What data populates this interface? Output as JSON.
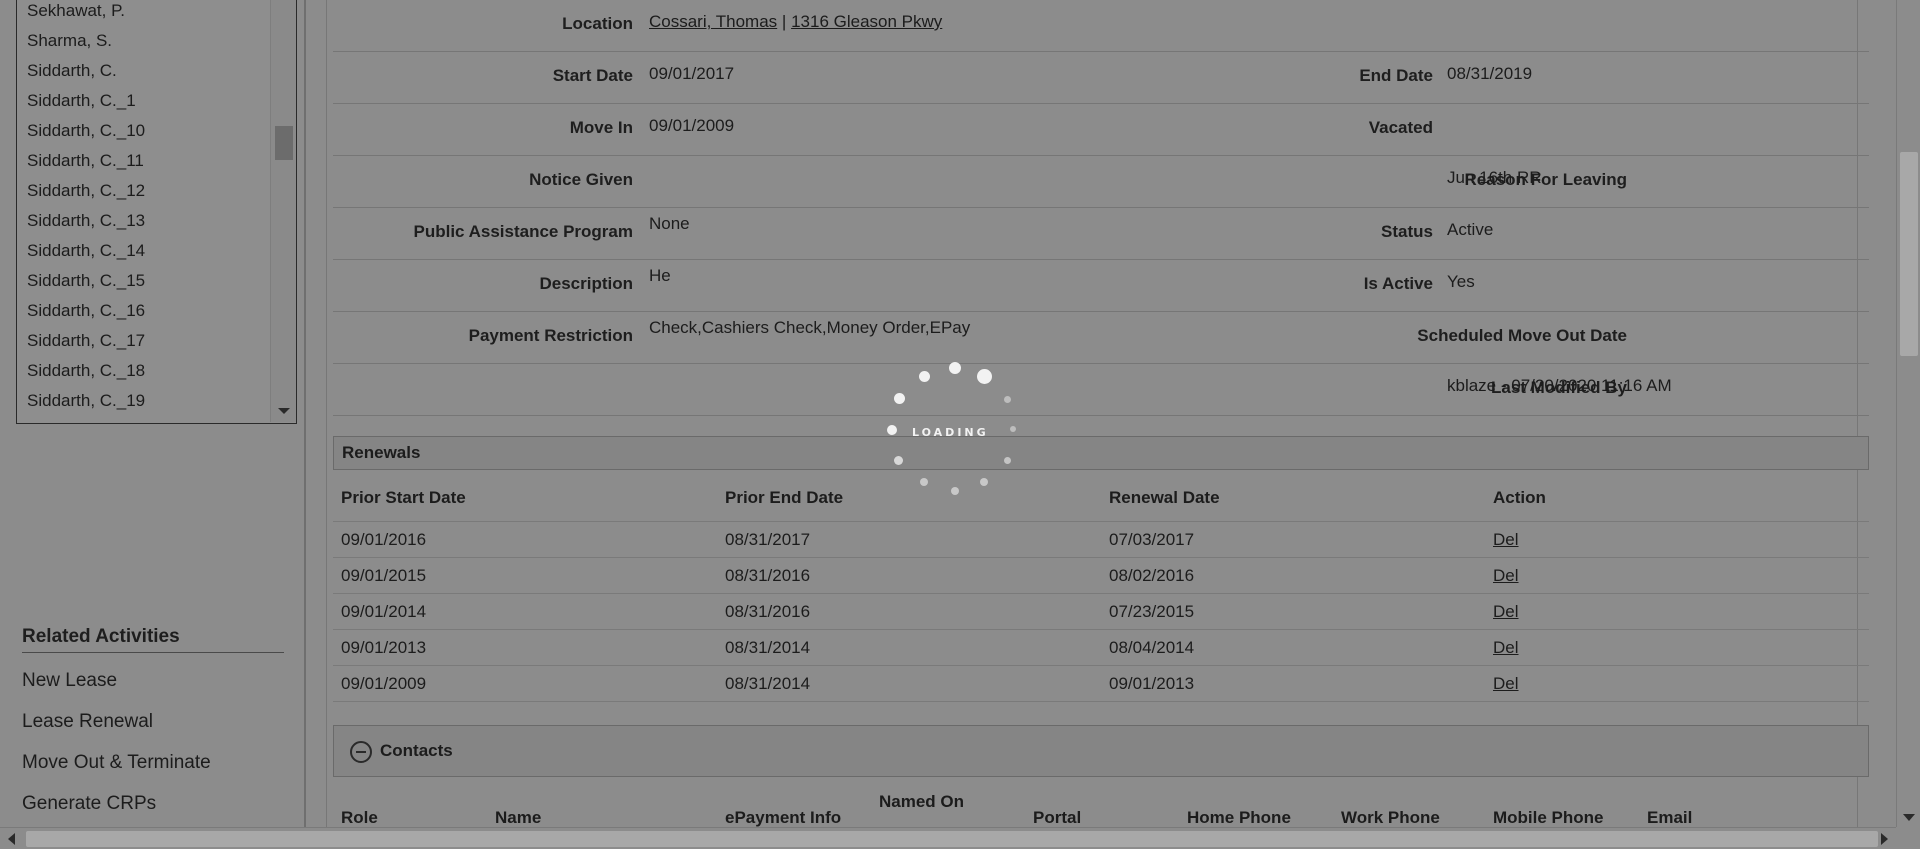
{
  "sidebar": {
    "names": [
      "Sekhawat, P.",
      "Sharma, S.",
      "Siddarth, C.",
      "Siddarth, C._1",
      "Siddarth, C._10",
      "Siddarth, C._11",
      "Siddarth, C._12",
      "Siddarth, C._13",
      "Siddarth, C._14",
      "Siddarth, C._15",
      "Siddarth, C._16",
      "Siddarth, C._17",
      "Siddarth, C._18",
      "Siddarth, C._19"
    ],
    "related_title": "Related Activities",
    "activities": [
      "New Lease",
      "Lease Renewal",
      "Move Out & Terminate",
      "Generate CRPs"
    ]
  },
  "details": {
    "location_label": "Location",
    "location_tenant": "Cossari, Thomas",
    "location_sep": "|",
    "location_address": "1316 Gleason Pkwy",
    "start_date_label": "Start Date",
    "start_date": "09/01/2017",
    "end_date_label": "End Date",
    "end_date": "08/31/2019",
    "move_in_label": "Move In",
    "move_in": "09/01/2009",
    "vacated_label": "Vacated",
    "vacated": "",
    "notice_label": "Notice Given",
    "notice": "",
    "reason_label": "Reason For Leaving",
    "reason": "Jun 16th RR",
    "assistance_label": "Public Assistance Program",
    "assistance": "None",
    "status_label": "Status",
    "status": "Active",
    "description_label": "Description",
    "description": "He",
    "is_active_label": "Is Active",
    "is_active": "Yes",
    "payment_label": "Payment Restriction",
    "payment": "Check,Cashiers Check,Money Order,EPay",
    "move_out_label": "Scheduled Move Out Date",
    "move_out": "",
    "modified_label": "Last Modified By",
    "modified": "kblaze - 07/20/2020 11:16 AM"
  },
  "loader": {
    "text": "LOADING"
  },
  "renewals": {
    "title": "Renewals",
    "headers": [
      "Prior Start Date",
      "Prior End Date",
      "Renewal Date",
      "Action"
    ],
    "rows": [
      [
        "09/01/2016",
        "08/31/2017",
        "07/03/2017",
        "Del"
      ],
      [
        "09/01/2015",
        "08/31/2016",
        "08/02/2016",
        "Del"
      ],
      [
        "09/01/2014",
        "08/31/2016",
        "07/23/2015",
        "Del"
      ],
      [
        "09/01/2013",
        "08/31/2014",
        "08/04/2014",
        "Del"
      ],
      [
        "09/01/2009",
        "08/31/2014",
        "09/01/2013",
        "Del"
      ]
    ]
  },
  "contacts": {
    "title": "Contacts",
    "columns": [
      "Role",
      "Name",
      "ePayment Info",
      "Named On",
      "Portal",
      "Home Phone",
      "Work Phone",
      "Mobile Phone",
      "Email"
    ]
  }
}
